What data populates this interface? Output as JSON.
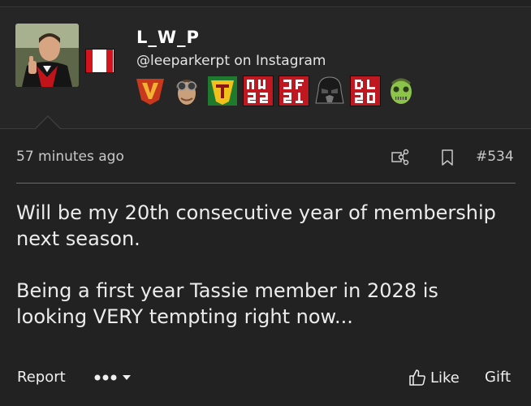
{
  "user": {
    "username": "L_W_P",
    "subtitle": "@leeparkerpt on Instagram"
  },
  "badges": [
    {
      "name": "v-badge-icon",
      "color": "#c8381c"
    },
    {
      "name": "aviator-badge-icon",
      "color": "#8a7a5a"
    },
    {
      "name": "tasmania-t-badge-icon",
      "color": "#1f7a2e"
    },
    {
      "name": "mw22-badge-icon",
      "color": "#c01820"
    },
    {
      "name": "jf21-badge-icon",
      "color": "#c01820"
    },
    {
      "name": "vader-badge-icon",
      "color": "#111111"
    },
    {
      "name": "dl20-badge-icon",
      "color": "#c01820"
    },
    {
      "name": "zombie-badge-icon",
      "color": "#8cc34a"
    }
  ],
  "post": {
    "time": "57 minutes ago",
    "number": "#534",
    "paragraphs": [
      "Will be my 20th consecutive year of membership next season.",
      "Being a first year Tassie member in 2028 is looking VERY tempting right now..."
    ]
  },
  "actions": {
    "report": "Report",
    "like": "Like",
    "gift": "Gift"
  }
}
